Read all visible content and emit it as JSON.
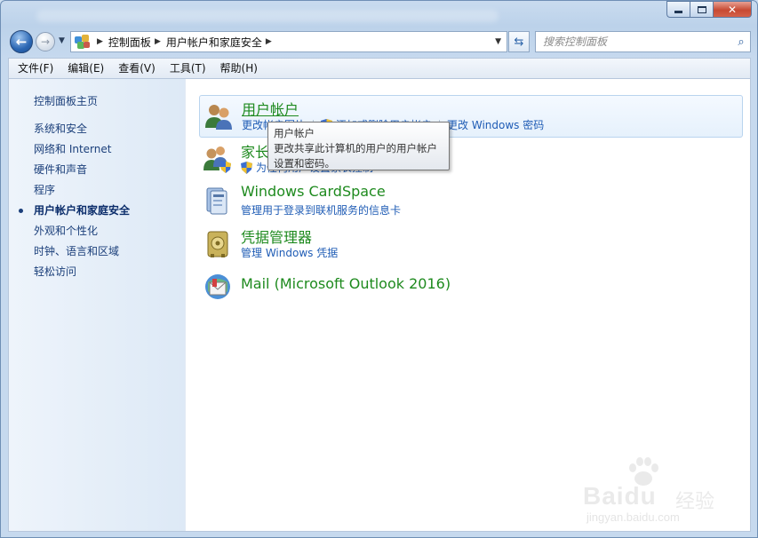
{
  "address_bar": {
    "crumbs": [
      "控制面板",
      "用户帐户和家庭安全"
    ]
  },
  "search": {
    "placeholder": "搜索控制面板"
  },
  "menu": [
    "文件(F)",
    "编辑(E)",
    "查看(V)",
    "工具(T)",
    "帮助(H)"
  ],
  "sidebar": {
    "home": "控制面板主页",
    "items": [
      {
        "label": "系统和安全",
        "active": false
      },
      {
        "label": "网络和 Internet",
        "active": false
      },
      {
        "label": "硬件和声音",
        "active": false
      },
      {
        "label": "程序",
        "active": false
      },
      {
        "label": "用户帐户和家庭安全",
        "active": true
      },
      {
        "label": "外观和个性化",
        "active": false
      },
      {
        "label": "时钟、语言和区域",
        "active": false
      },
      {
        "label": "轻松访问",
        "active": false
      }
    ]
  },
  "categories": [
    {
      "title": "用户帐户",
      "links": [
        "更改帐户图片",
        "添加或删除用户帐户",
        "更改 Windows 密码"
      ],
      "icon": "users-icon"
    },
    {
      "title": "家长控制",
      "links": [
        "为任何用户设置家长控制"
      ],
      "icon": "parental-controls-icon"
    },
    {
      "title": "Windows CardSpace",
      "links": [
        "管理用于登录到联机服务的信息卡"
      ],
      "icon": "cardspace-icon"
    },
    {
      "title": "凭据管理器",
      "links": [
        "管理 Windows 凭据"
      ],
      "icon": "credential-vault-icon"
    },
    {
      "title": "Mail (Microsoft Outlook 2016)",
      "links": [],
      "icon": "mail-icon"
    }
  ],
  "tooltip": {
    "title": "用户帐户",
    "body_line1": "更改共享此计算机的用户的用户帐户",
    "body_line2": "设置和密码。"
  },
  "watermark": {
    "brand": "Baidu",
    "cn": "经验",
    "url": "jingyan.baidu.com"
  },
  "colors": {
    "category_title": "#1e8a1e",
    "link": "#1f5cb5",
    "sidebar_link": "#1b3f7a"
  }
}
